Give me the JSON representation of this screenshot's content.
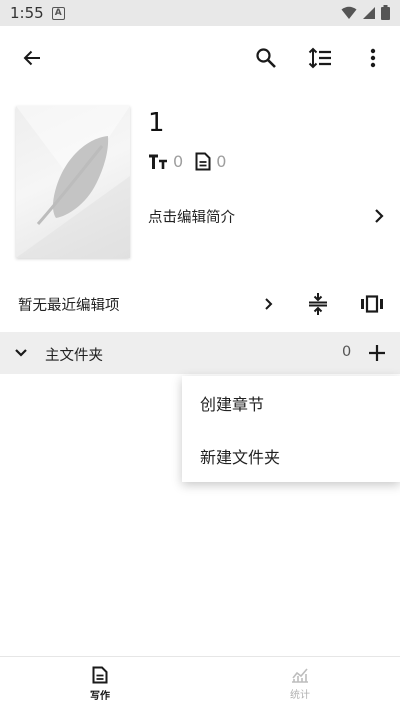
{
  "status_bar": {
    "time": "1:55",
    "badge": "A"
  },
  "toolbar": {
    "back_icon": "arrow-left-icon",
    "search_icon": "search-icon",
    "sort_icon": "sort-icon",
    "more_icon": "more-vertical-icon"
  },
  "book": {
    "title": "1",
    "word_count": "0",
    "chapter_count": "0",
    "intro_placeholder": "点击编辑简介"
  },
  "recent": {
    "label": "暂无最近编辑项"
  },
  "folder": {
    "name": "主文件夹",
    "count": "0"
  },
  "context_menu": {
    "items": [
      "创建章节",
      "新建文件夹"
    ]
  },
  "bottom_nav": {
    "items": [
      {
        "label": "写作",
        "active": true
      },
      {
        "label": "统计",
        "active": false
      }
    ]
  },
  "colors": {
    "accent": "#111111",
    "muted": "#9e9e9e",
    "folder_bg": "#eeeeee"
  }
}
